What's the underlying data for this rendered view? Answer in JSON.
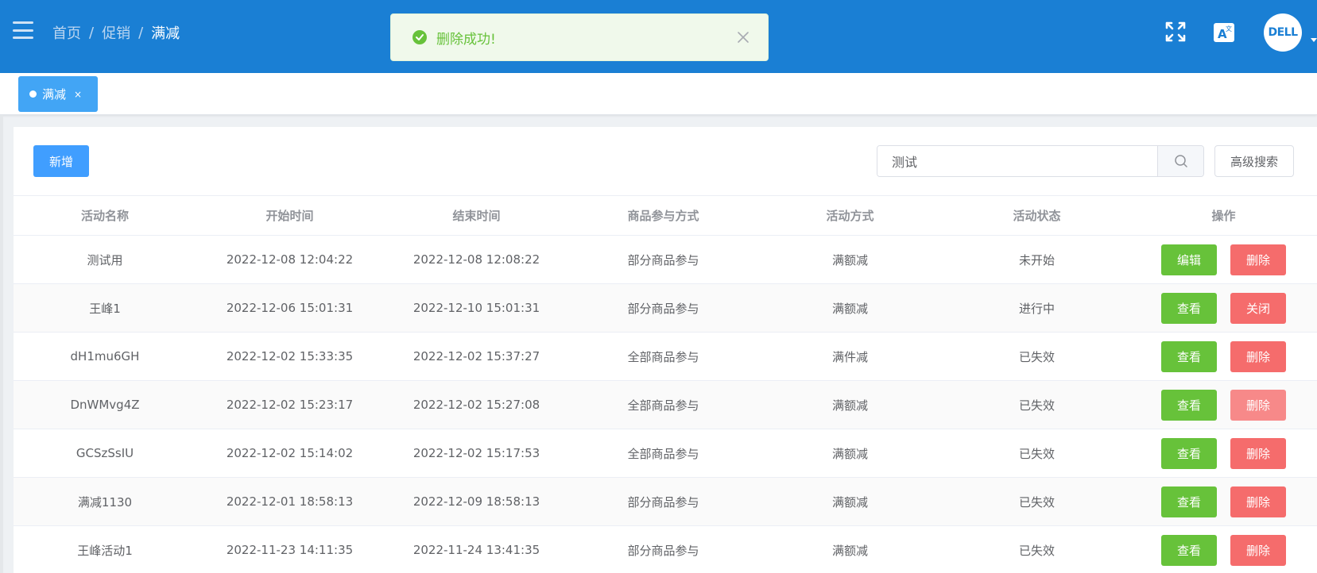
{
  "header": {
    "breadcrumb": [
      "首页",
      "促销",
      "满减"
    ],
    "avatar_text": "DELL",
    "color": "#1a7fd4"
  },
  "toast": {
    "message": "删除成功!",
    "type": "success"
  },
  "tags": [
    {
      "label": "满减",
      "close": "×"
    }
  ],
  "toolbar": {
    "add_label": "新增",
    "search_value": "测试",
    "advanced_label": "高级搜索"
  },
  "table": {
    "columns": [
      "活动名称",
      "开始时间",
      "结束时间",
      "商品参与方式",
      "活动方式",
      "活动状态",
      "操作"
    ],
    "rows": [
      {
        "name": "测试用",
        "start": "2022-12-08 12:04:22",
        "end": "2022-12-08 12:08:22",
        "scope": "部分商品参与",
        "mode": "满额减",
        "status": "未开始",
        "op1": "编辑",
        "op2": "删除"
      },
      {
        "name": "王峰1",
        "start": "2022-12-06 15:01:31",
        "end": "2022-12-10 15:01:31",
        "scope": "部分商品参与",
        "mode": "满额减",
        "status": "进行中",
        "op1": "查看",
        "op2": "关闭"
      },
      {
        "name": "dH1mu6GH",
        "start": "2022-12-02 15:33:35",
        "end": "2022-12-02 15:37:27",
        "scope": "全部商品参与",
        "mode": "满件减",
        "status": "已失效",
        "op1": "查看",
        "op2": "删除"
      },
      {
        "name": "DnWMvg4Z",
        "start": "2022-12-02 15:23:17",
        "end": "2022-12-02 15:27:08",
        "scope": "全部商品参与",
        "mode": "满额减",
        "status": "已失效",
        "op1": "查看",
        "op2": "删除"
      },
      {
        "name": "GCSzSsIU",
        "start": "2022-12-02 15:14:02",
        "end": "2022-12-02 15:17:53",
        "scope": "全部商品参与",
        "mode": "满额减",
        "status": "已失效",
        "op1": "查看",
        "op2": "删除"
      },
      {
        "name": "满减1130",
        "start": "2022-12-01 18:58:13",
        "end": "2022-12-09 18:58:13",
        "scope": "部分商品参与",
        "mode": "满额减",
        "status": "已失效",
        "op1": "查看",
        "op2": "删除"
      },
      {
        "name": "王峰活动1",
        "start": "2022-11-23 14:11:35",
        "end": "2022-11-24 13:41:35",
        "scope": "部分商品参与",
        "mode": "满额减",
        "status": "已失效",
        "op1": "查看",
        "op2": "删除"
      }
    ]
  }
}
